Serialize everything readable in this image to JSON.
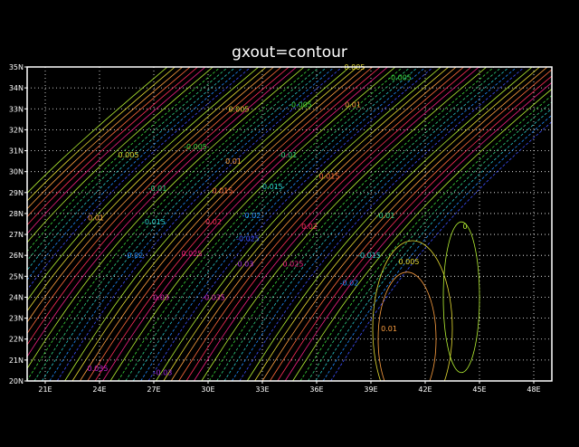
{
  "chart_data": {
    "type": "contour",
    "title": "gxout=contour",
    "x_range": [
      20,
      49
    ],
    "y_range": [
      20,
      35
    ],
    "x_ticks": [
      {
        "value": 21,
        "label": "21E"
      },
      {
        "value": 24,
        "label": "24E"
      },
      {
        "value": 27,
        "label": "27E"
      },
      {
        "value": 30,
        "label": "30E"
      },
      {
        "value": 33,
        "label": "33E"
      },
      {
        "value": 36,
        "label": "36E"
      },
      {
        "value": 39,
        "label": "39E"
      },
      {
        "value": 42,
        "label": "42E"
      },
      {
        "value": 45,
        "label": "45E"
      },
      {
        "value": 48,
        "label": "48E"
      }
    ],
    "y_ticks": [
      {
        "value": 20,
        "label": "20N"
      },
      {
        "value": 21,
        "label": "21N"
      },
      {
        "value": 22,
        "label": "22N"
      },
      {
        "value": 23,
        "label": "23N"
      },
      {
        "value": 24,
        "label": "24N"
      },
      {
        "value": 25,
        "label": "25N"
      },
      {
        "value": 26,
        "label": "26N"
      },
      {
        "value": 27,
        "label": "27N"
      },
      {
        "value": 28,
        "label": "28N"
      },
      {
        "value": 29,
        "label": "29N"
      },
      {
        "value": 30,
        "label": "30N"
      },
      {
        "value": 31,
        "label": "31N"
      },
      {
        "value": 32,
        "label": "32N"
      },
      {
        "value": 33,
        "label": "33N"
      },
      {
        "value": 34,
        "label": "34N"
      },
      {
        "value": 35,
        "label": "35N"
      }
    ],
    "grid": true,
    "level_colors": {
      "0.015": "#ff6a3c",
      "0.01": "#ffa040",
      "0.005": "#e6dc32",
      "0": "#b4f032",
      "-0.005": "#3cdc3c",
      "-0.01": "#30d280",
      "-0.015": "#28c8c8",
      "-0.02": "#1e8cff",
      "-0.025": "#3c50ff",
      "-0.03": "#a028dc",
      "-0.035": "#d21eb4",
      "0.02": "#ff2d5a",
      "0.025": "#f02082",
      "0.03": "#dc1eaa",
      "0.035": "#c81ed2"
    },
    "contour_labels": [
      {
        "text": "0.005",
        "x": 38.1,
        "y": 35.0,
        "level": 0.005
      },
      {
        "text": "-0.005",
        "x": 40.6,
        "y": 34.5,
        "level": -0.005
      },
      {
        "text": "-0.005",
        "x": 35.1,
        "y": 33.2,
        "level": -0.005
      },
      {
        "text": "0.01",
        "x": 38.0,
        "y": 33.2,
        "level": 0.01
      },
      {
        "text": "0.005",
        "x": 31.7,
        "y": 33.0,
        "level": 0.005
      },
      {
        "text": "-0.005",
        "x": 29.3,
        "y": 31.2,
        "level": -0.005
      },
      {
        "text": "-0.01",
        "x": 34.4,
        "y": 30.8,
        "level": -0.01
      },
      {
        "text": "0.005",
        "x": 25.6,
        "y": 30.8,
        "level": 0.005
      },
      {
        "text": "0.01",
        "x": 31.4,
        "y": 30.5,
        "level": 0.01
      },
      {
        "text": "0.015",
        "x": 36.7,
        "y": 29.8,
        "level": 0.015
      },
      {
        "text": "-0.01",
        "x": 27.2,
        "y": 29.2,
        "level": -0.01
      },
      {
        "text": "0.015",
        "x": 30.8,
        "y": 29.1,
        "level": 0.015
      },
      {
        "text": "-0.015",
        "x": 33.5,
        "y": 29.3,
        "level": -0.015
      },
      {
        "text": "-0.01",
        "x": 39.8,
        "y": 27.9,
        "level": -0.01
      },
      {
        "text": "0.01",
        "x": 23.8,
        "y": 27.8,
        "level": 0.01
      },
      {
        "text": "-0.02",
        "x": 32.4,
        "y": 27.9,
        "level": -0.02
      },
      {
        "text": "-0.015",
        "x": 27.0,
        "y": 27.6,
        "level": -0.015
      },
      {
        "text": "0.02",
        "x": 30.3,
        "y": 27.6,
        "level": 0.02
      },
      {
        "text": "0.02",
        "x": 35.6,
        "y": 27.4,
        "level": 0.02
      },
      {
        "text": "-0.025",
        "x": 32.2,
        "y": 26.8,
        "level": -0.025
      },
      {
        "text": "0",
        "x": 44.2,
        "y": 27.4,
        "level": 0
      },
      {
        "text": "-0.02",
        "x": 25.9,
        "y": 26.0,
        "level": -0.02
      },
      {
        "text": "0.025",
        "x": 29.1,
        "y": 26.1,
        "level": 0.025
      },
      {
        "text": "-0.015",
        "x": 38.9,
        "y": 26.0,
        "level": -0.015
      },
      {
        "text": "-0.03",
        "x": 32.0,
        "y": 25.6,
        "level": -0.03
      },
      {
        "text": "0.025",
        "x": 34.7,
        "y": 25.6,
        "level": 0.025
      },
      {
        "text": "0.005",
        "x": 41.1,
        "y": 25.7,
        "level": 0.005
      },
      {
        "text": "-0.02",
        "x": 37.8,
        "y": 24.7,
        "level": -0.02
      },
      {
        "text": "0.03",
        "x": 27.4,
        "y": 24.0,
        "level": 0.03
      },
      {
        "text": "-0.035",
        "x": 30.3,
        "y": 24.0,
        "level": -0.035
      },
      {
        "text": "0.01",
        "x": 40.0,
        "y": 22.5,
        "level": 0.01
      },
      {
        "text": "0.035",
        "x": 23.9,
        "y": 20.6,
        "level": 0.035
      },
      {
        "text": "-0.03",
        "x": 27.5,
        "y": 20.4,
        "level": -0.03
      }
    ]
  }
}
